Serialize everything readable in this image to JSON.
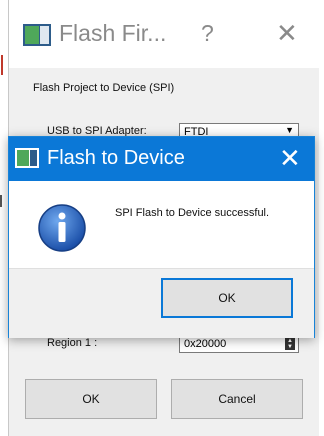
{
  "background_window": {
    "title": "Flash Fir...",
    "help_label": "?",
    "close_label": "✕",
    "heading": "Flash Project to Device (SPI)",
    "adapter_label": "USB to SPI Adapter:",
    "adapter_value": "FTDI",
    "region_label": "Region 1 :",
    "region_value": "0x20000",
    "ok_label": "OK",
    "cancel_label": "Cancel"
  },
  "dialog": {
    "title": "Flash to Device",
    "close_label": "✕",
    "message": "SPI Flash to Device successful.",
    "ok_label": "OK"
  },
  "colors": {
    "dialog_title_bar": "#0b78d7",
    "dialog_border": "#1883d7",
    "window_bg": "#f0f0f0",
    "button_bg": "#e1e1e1"
  }
}
